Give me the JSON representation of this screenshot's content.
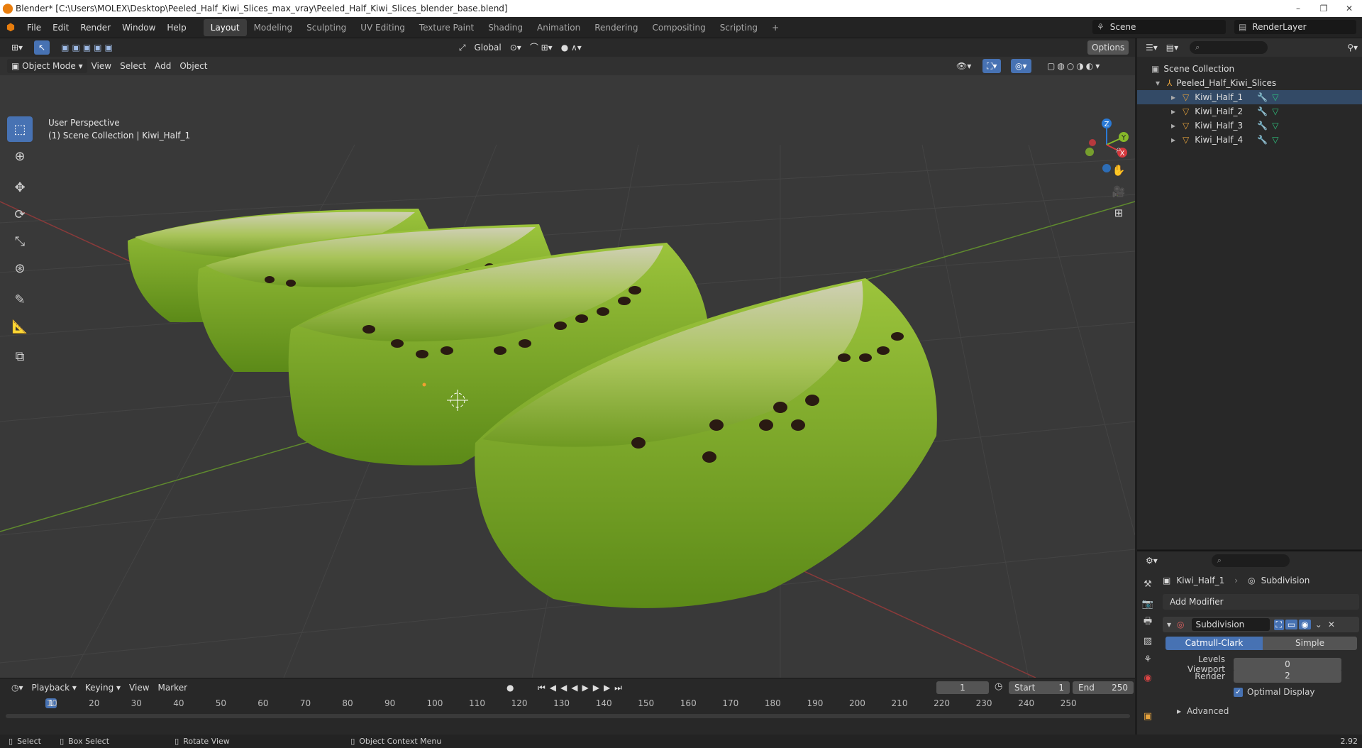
{
  "window": {
    "title": "Blender* [C:\\Users\\MOLEX\\Desktop\\Peeled_Half_Kiwi_Slices_max_vray\\Peeled_Half_Kiwi_Slices_blender_base.blend]",
    "minimize": "–",
    "restore": "❐",
    "close": "✕"
  },
  "menu": [
    "File",
    "Edit",
    "Render",
    "Window",
    "Help"
  ],
  "workspaces": [
    "Layout",
    "Modeling",
    "Sculpting",
    "UV Editing",
    "Texture Paint",
    "Shading",
    "Animation",
    "Rendering",
    "Compositing",
    "Scripting",
    "+"
  ],
  "active_workspace": "Layout",
  "scene": {
    "name": "Scene",
    "render_layer": "RenderLayer"
  },
  "viewport_header": {
    "transform_orientation": "Global",
    "options": "Options",
    "mode": "Object Mode",
    "menus": [
      "View",
      "Select",
      "Add",
      "Object"
    ]
  },
  "viewport": {
    "perspective": "User Perspective",
    "collection_info": "(1) Scene Collection | Kiwi_Half_1"
  },
  "gizmo_axes": {
    "z": "Z",
    "y": "Y",
    "x": "X"
  },
  "colors": {
    "x_axis": "#d6393e",
    "y_axis": "#86b82a",
    "z_axis": "#2a7ad6",
    "accent": "#4772b3",
    "kiwi": "#7eae2a"
  },
  "outliner": {
    "root": "Scene Collection",
    "collection": "Peeled_Half_Kiwi_Slices",
    "objects": [
      "Kiwi_Half_1",
      "Kiwi_Half_2",
      "Kiwi_Half_3",
      "Kiwi_Half_4"
    ]
  },
  "properties": {
    "object": "Kiwi_Half_1",
    "modifier_crumb": "Subdivision",
    "add_modifier": "Add Modifier",
    "modifier_name": "Subdivision",
    "type_options": [
      "Catmull-Clark",
      "Simple"
    ],
    "active_type": "Catmull-Clark",
    "levels_viewport_label": "Levels Viewport",
    "levels_viewport": "0",
    "render_label": "Render",
    "render": "2",
    "optimal_display": "Optimal Display",
    "advanced": "Advanced"
  },
  "timeline": {
    "menus": [
      "Playback",
      "Keying",
      "View",
      "Marker"
    ],
    "current_frame": "1",
    "start_label": "Start",
    "start": "1",
    "end_label": "End",
    "end": "250",
    "ticks": [
      "1",
      "10",
      "20",
      "30",
      "40",
      "50",
      "60",
      "70",
      "80",
      "90",
      "100",
      "110",
      "120",
      "130",
      "140",
      "150",
      "160",
      "170",
      "180",
      "190",
      "200",
      "210",
      "220",
      "230",
      "240",
      "250"
    ]
  },
  "statusbar": {
    "select": "Select",
    "box_select": "Box Select",
    "rotate_view": "Rotate View",
    "context_menu": "Object Context Menu",
    "version": "2.92"
  }
}
